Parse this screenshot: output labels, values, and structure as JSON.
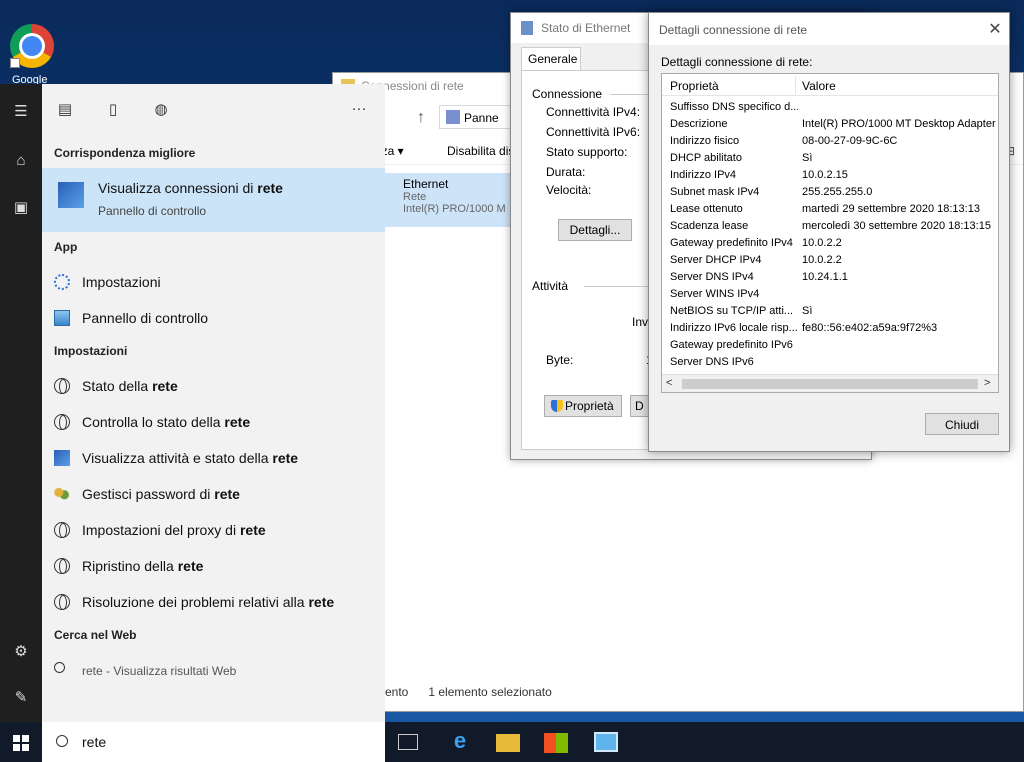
{
  "desktop": {
    "shortcut_label": "Google"
  },
  "explorer": {
    "title": "Connessioni di rete",
    "address": "Panne",
    "cmd1": "izza ▾",
    "cmd2": "Disabilita dis",
    "cmd_right": "⊟",
    "tile": {
      "name": "Ethernet",
      "status": "Rete",
      "adapter": "Intel(R) PRO/1000 M"
    },
    "status_left": "ento",
    "status_selected": "1 elemento selezionato"
  },
  "stato": {
    "title": "Stato di Ethernet",
    "tab": "Generale",
    "group_connection": "Connessione",
    "fields": [
      "Connettività IPv4:",
      "Connettività IPv6:",
      "Stato supporto:",
      "Durata:",
      "Velocità:"
    ],
    "details_button": "Dettagli...",
    "group_activity": "Attività",
    "sent_partial": "Invi",
    "bytes_label": "Byte:",
    "bytes_partial": "1",
    "properties_button": "Proprietà",
    "disable_partial": "D"
  },
  "dettagli": {
    "title": "Dettagli connessione di rete",
    "subtitle": "Dettagli connessione di rete:",
    "col_property": "Proprietà",
    "col_value": "Valore",
    "rows": [
      {
        "p": "Suffisso DNS specifico d...",
        "v": ""
      },
      {
        "p": "Descrizione",
        "v": "Intel(R) PRO/1000 MT Desktop Adapter"
      },
      {
        "p": "Indirizzo fisico",
        "v": "08-00-27-09-9C-6C"
      },
      {
        "p": "DHCP abilitato",
        "v": "Sì"
      },
      {
        "p": "Indirizzo IPv4",
        "v": "10.0.2.15"
      },
      {
        "p": "Subnet mask IPv4",
        "v": "255.255.255.0"
      },
      {
        "p": "Lease ottenuto",
        "v": "martedì 29 settembre 2020 18:13:13"
      },
      {
        "p": "Scadenza lease",
        "v": "mercoledì 30 settembre 2020 18:13:15"
      },
      {
        "p": "Gateway predefinito IPv4",
        "v": "10.0.2.2"
      },
      {
        "p": "Server DHCP IPv4",
        "v": "10.0.2.2"
      },
      {
        "p": "Server DNS IPv4",
        "v": "10.24.1.1"
      },
      {
        "p": "Server WINS IPv4",
        "v": ""
      },
      {
        "p": "NetBIOS su TCP/IP atti...",
        "v": "Sì"
      },
      {
        "p": "Indirizzo IPv6 locale risp...",
        "v": "fe80::56:e402:a59a:9f72%3"
      },
      {
        "p": "Gateway predefinito IPv6",
        "v": ""
      },
      {
        "p": "Server DNS IPv6",
        "v": ""
      }
    ],
    "close_button": "Chiudi"
  },
  "start": {
    "best_match_header": "Corrispondenza migliore",
    "best": {
      "title_plain": "Visualizza connessioni di ",
      "title_bold": "rete",
      "subtitle": "Pannello di controllo"
    },
    "app_header": "App",
    "apps": [
      "Impostazioni",
      "Pannello di controllo"
    ],
    "settings_header": "Impostazioni",
    "settings": [
      {
        "plain": "Stato della ",
        "bold": "rete"
      },
      {
        "plain": "Controlla lo stato della ",
        "bold": "rete"
      },
      {
        "plain": "Visualizza attività e stato della ",
        "bold": "rete"
      },
      {
        "plain": "Gestisci password di ",
        "bold": "rete"
      },
      {
        "plain": "Impostazioni del proxy di ",
        "bold": "rete"
      },
      {
        "plain": "Ripristino della ",
        "bold": "rete"
      },
      {
        "plain": "Risoluzione dei problemi relativi alla ",
        "bold": "rete"
      }
    ],
    "web_header": "Cerca nel Web",
    "web": {
      "query": "rete",
      "hint": " - Visualizza risultati Web"
    },
    "more_label": "···"
  },
  "taskbar": {
    "search_value": "rete"
  }
}
